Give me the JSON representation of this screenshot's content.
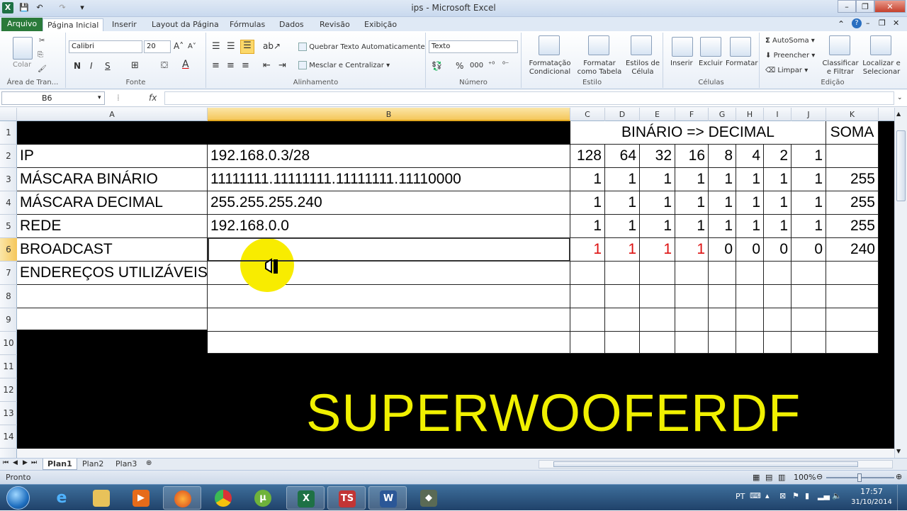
{
  "window": {
    "title": "ips  -  Microsoft Excel"
  },
  "tabs": [
    {
      "label": "Arquivo"
    },
    {
      "label": "Página Inicial"
    },
    {
      "label": "Inserir"
    },
    {
      "label": "Layout da Página"
    },
    {
      "label": "Fórmulas"
    },
    {
      "label": "Dados"
    },
    {
      "label": "Revisão"
    },
    {
      "label": "Exibição"
    }
  ],
  "ribbon": {
    "clipboard": {
      "group": "Área de Tran...",
      "paste": "Colar"
    },
    "font": {
      "group": "Fonte",
      "name": "Calibri",
      "size": "20",
      "bold": "N",
      "italic": "I",
      "underline": "S"
    },
    "alignment": {
      "group": "Alinhamento",
      "wrap": "Quebrar Texto Automaticamente",
      "merge": "Mesclar e Centralizar"
    },
    "number": {
      "group": "Número",
      "format": "Texto",
      "percent": "%",
      "thousands": "000"
    },
    "styles": {
      "group": "Estilo",
      "conditional": "Formatação Condicional",
      "table": "Formatar como Tabela",
      "cell": "Estilos de Célula"
    },
    "cells": {
      "group": "Células",
      "insert": "Inserir",
      "delete": "Excluir",
      "format": "Formatar"
    },
    "editing": {
      "group": "Edição",
      "autosum": "AutoSoma",
      "fill": "Preencher",
      "clear": "Limpar",
      "sort": "Classificar e Filtrar",
      "find": "Localizar e Selecionar"
    }
  },
  "formula_bar": {
    "name_box": "B6",
    "fx": "fx",
    "value": ""
  },
  "columns": [
    "A",
    "B",
    "C",
    "D",
    "E",
    "F",
    "G",
    "H",
    "I",
    "J",
    "K"
  ],
  "rows": [
    "1",
    "2",
    "3",
    "4",
    "5",
    "6",
    "7",
    "8",
    "9",
    "10",
    "11",
    "12",
    "13",
    "14"
  ],
  "sheet": {
    "header_title": "BINÁRIO => DECIMAL",
    "header_sum": "SOMA",
    "labels": [
      "IP",
      "MÁSCARA BINÁRIO",
      "MÁSCARA DECIMAL",
      "REDE",
      "BROADCAST",
      "ENDEREÇOS UTILIZÁVEIS"
    ],
    "values": [
      "192.168.0.3/28",
      "11111111.11111111.11111111.11110000",
      "255.255.255.240",
      "192.168.0.0",
      "",
      ""
    ],
    "bit_weights": [
      "128",
      "64",
      "32",
      "16",
      "8",
      "4",
      "2",
      "1"
    ],
    "bit_rows": [
      {
        "bits": [
          "1",
          "1",
          "1",
          "1",
          "1",
          "1",
          "1",
          "1"
        ],
        "sum": "255"
      },
      {
        "bits": [
          "1",
          "1",
          "1",
          "1",
          "1",
          "1",
          "1",
          "1"
        ],
        "sum": "255"
      },
      {
        "bits": [
          "1",
          "1",
          "1",
          "1",
          "1",
          "1",
          "1",
          "1"
        ],
        "sum": "255"
      },
      {
        "bits": [
          "1",
          "1",
          "1",
          "1",
          "0",
          "0",
          "0",
          "0"
        ],
        "sum": "240"
      }
    ],
    "red_color": "#dd1111"
  },
  "watermark": "SUPERWOOFERDF",
  "sheet_tabs": [
    "Plan1",
    "Plan2",
    "Plan3"
  ],
  "status": {
    "ready": "Pronto",
    "zoom": "100%"
  },
  "taskbar": {
    "lang": "PT",
    "time": "17:57",
    "date": "31/10/2014",
    "apps": [
      "internet-explorer",
      "file-explorer",
      "media-player",
      "firefox",
      "chrome",
      "utorrent",
      "excel",
      "camtasia",
      "word",
      "video-tool"
    ]
  }
}
